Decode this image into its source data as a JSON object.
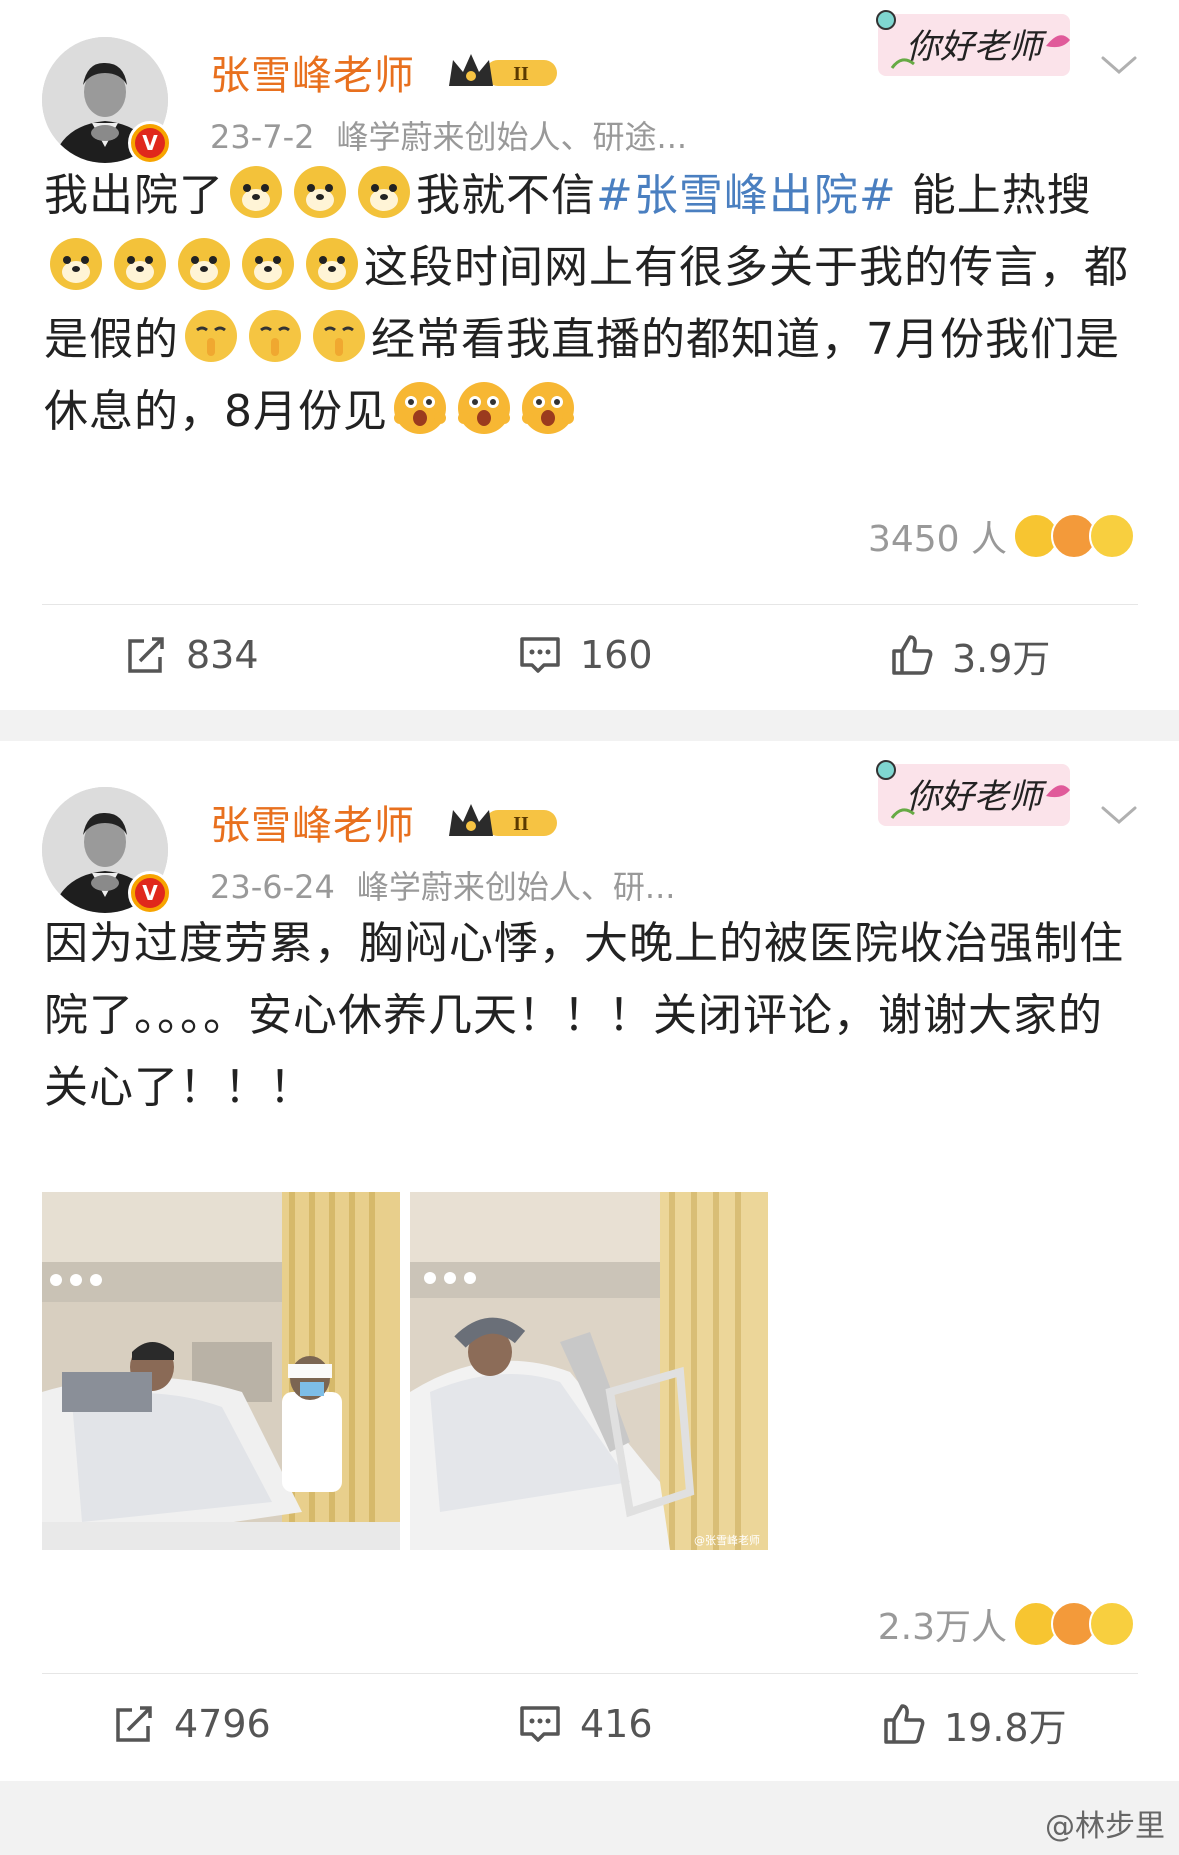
{
  "posts": [
    {
      "username": "张雪峰老师",
      "date": "23-7-2",
      "source": "峰学蔚来创始人、研途...",
      "sticker_text": "你好老师",
      "text_before_tag": "我出院了",
      "text_mid": "我就不信",
      "hashtag": "#张雪峰出院#",
      "text_after_tag": " 能上热搜",
      "text_rumor": "这段时间网上有很多关于我的传言，都是假的",
      "text_end": "经常看我直播的都知道，7月份我们是休息的，8月份见",
      "reaction_count": "3450 人",
      "reposts": "834",
      "comments": "160",
      "likes": "3.9万"
    },
    {
      "username": "张雪峰老师",
      "date": "23-6-24",
      "source": "峰学蔚来创始人、研...",
      "sticker_text": "你好老师",
      "text": "因为过度劳累，胸闷心悸，大晚上的被医院收治强制住院了。。。。安心休养几天！！！关闭评论，谢谢大家的关心了！！！",
      "photo_watermark": "@张雪峰老师",
      "reaction_count": "2.3万人",
      "reposts": "4796",
      "comments": "416",
      "likes": "19.8万"
    }
  ],
  "footer_watermark": "@林步里",
  "colors": {
    "username": "#e8701e",
    "hashtag": "#4a7fc0",
    "meta": "#999999",
    "separator": "#f2f2f2"
  },
  "icons": [
    "crown-badge-icon",
    "verified-v-icon",
    "chevron-down-icon",
    "repost-icon",
    "comment-icon",
    "like-icon",
    "doge-emoji",
    "shush-emoji",
    "surprised-emoji"
  ]
}
